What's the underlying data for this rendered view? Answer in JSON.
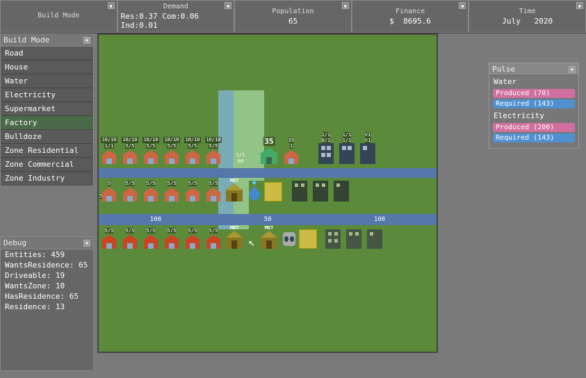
{
  "topbar": {
    "panels": [
      {
        "id": "build-mode",
        "title": "Build Mode",
        "value": "",
        "value2": ""
      },
      {
        "id": "demand",
        "title": "Demand",
        "value": "Res:0.37 Com:0.06 Ind:0.01",
        "value2": ""
      },
      {
        "id": "population",
        "title": "Population",
        "value": "65",
        "value2": ""
      },
      {
        "id": "finance",
        "title": "Finance",
        "value": "$",
        "value2": "8695.6"
      },
      {
        "id": "time",
        "title": "Time",
        "value": "July",
        "value2": "2020"
      }
    ]
  },
  "sidebar": {
    "title": "Build Mode",
    "items": [
      {
        "label": "Road",
        "active": false
      },
      {
        "label": "House",
        "active": false
      },
      {
        "label": "Water",
        "active": false
      },
      {
        "label": "Electricity",
        "active": false
      },
      {
        "label": "Supermarket",
        "active": false
      },
      {
        "label": "Factory",
        "active": true
      },
      {
        "label": "Bulldoze",
        "active": false
      },
      {
        "label": "Zone Residential",
        "active": false
      },
      {
        "label": "Zone Commercial",
        "active": false
      },
      {
        "label": "Zone Industry",
        "active": false
      }
    ]
  },
  "debug": {
    "title": "Debug",
    "items": [
      {
        "label": "Entities: 459"
      },
      {
        "label": "WantsResidence: 65"
      },
      {
        "label": "Driveable: 19"
      },
      {
        "label": "WantsZone: 10"
      },
      {
        "label": "HasResidence: 65"
      },
      {
        "label": "Residence: 13"
      }
    ]
  },
  "pulse": {
    "title": "Pulse",
    "sections": [
      {
        "title": "Water",
        "bars": [
          {
            "label": "Produced (70)",
            "type": "pink"
          },
          {
            "label": "Required (143)",
            "type": "blue"
          }
        ]
      },
      {
        "title": "Electricity",
        "bars": [
          {
            "label": "Produced (200)",
            "type": "pink"
          },
          {
            "label": "Required (143)",
            "type": "blue"
          }
        ]
      }
    ]
  },
  "icons": {
    "close": "▪",
    "cursor": "↖"
  }
}
